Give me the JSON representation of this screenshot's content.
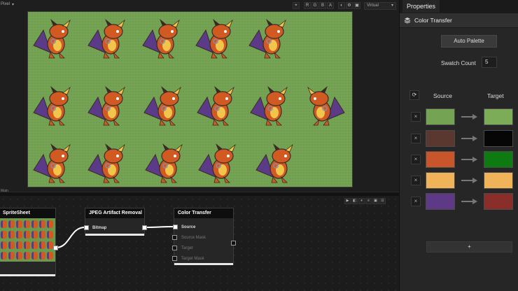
{
  "viewport": {
    "menu_label": "Pixel",
    "toolbar": [
      "⌖",
      "R",
      "G",
      "B",
      "A",
      "◐",
      "⚙",
      "▣"
    ],
    "zoom_value": "Virtual",
    "pane_label": "Main"
  },
  "graph": {
    "toolbar": [
      "▶",
      "◧",
      "⏸",
      "≡",
      "▣",
      "⊡"
    ],
    "nodes": {
      "sprite": {
        "title": "SpriteSheet"
      },
      "jpeg": {
        "title": "JPEG Artifact Removal",
        "output_label": "Bitmap"
      },
      "color": {
        "title": "Color Transfer",
        "inputs": [
          "Source",
          "Source Mask",
          "Target",
          "Target Mask"
        ]
      }
    }
  },
  "properties": {
    "tab": "Properties",
    "section": "Color Transfer",
    "auto_palette_label": "Auto Palette",
    "swatch_count_label": "Swatch Count",
    "swatch_count_value": "5",
    "source_header": "Source",
    "target_header": "Target",
    "remove_label": "×",
    "add_label": "+",
    "swatches": [
      {
        "source": "#74a353",
        "target": "#7dac58"
      },
      {
        "source": "#5a382f",
        "target": "#060606"
      },
      {
        "source": "#c8562a",
        "target": "#0e7a12"
      },
      {
        "source": "#f0b35a",
        "target": "#f0b35a"
      },
      {
        "source": "#5e3a86",
        "target": "#8a2e29"
      }
    ]
  },
  "colors": {
    "canvas_bg": "#74a353",
    "sprite_body": "#d05a22",
    "sprite_wing": "#5b3a87",
    "sprite_horn": "#f1c44b",
    "sprite_dark": "#3a2a24"
  }
}
